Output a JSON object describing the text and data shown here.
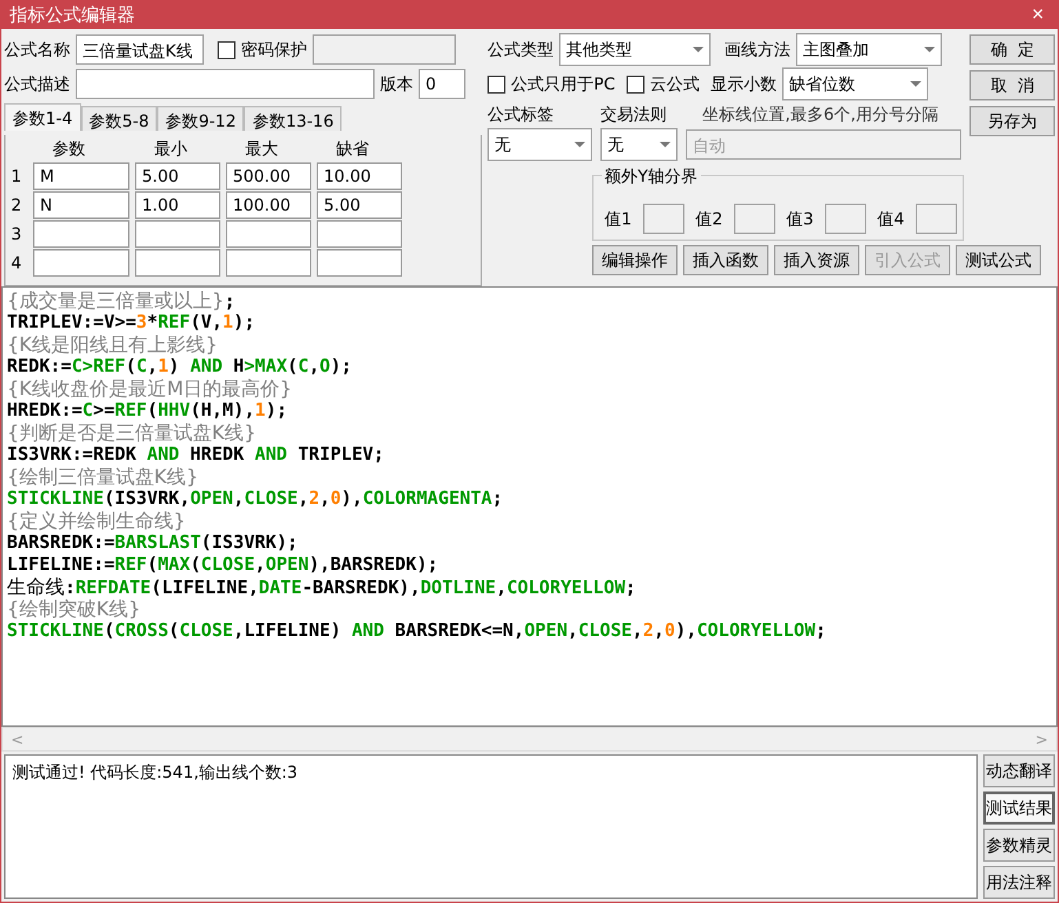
{
  "window": {
    "title": "指标公式编辑器",
    "close": "×"
  },
  "form": {
    "name_label": "公式名称",
    "name_value": "三倍量试盘K线",
    "password": {
      "label": "密码保护",
      "checked": false
    },
    "desc_label": "公式描述",
    "version_label": "版本",
    "version_value": "0",
    "type_label": "公式类型",
    "type_value": "其他类型",
    "draw_label": "画线方法",
    "draw_value": "主图叠加",
    "pc_only": {
      "label": "公式只用于PC",
      "checked": false
    },
    "cloud": {
      "label": "云公式",
      "checked": false
    },
    "decimals_label": "显示小数",
    "decimals_value": "缺省位数",
    "tag_label": "公式标签",
    "tag_value": "无",
    "rule_label": "交易法则",
    "rule_value": "无",
    "axis_label": "坐标线位置,最多6个,用分号分隔",
    "axis_placeholder": "自动",
    "yaxis_title": "额外Y轴分界",
    "yaxis_values": [
      "值1",
      "值2",
      "值3",
      "值4"
    ]
  },
  "tabs": [
    {
      "label": "参数1-4",
      "selected": true
    },
    {
      "label": "参数5-8",
      "selected": false
    },
    {
      "label": "参数9-12",
      "selected": false
    },
    {
      "label": "参数13-16",
      "selected": false
    }
  ],
  "params": {
    "columns": [
      "参数",
      "最小",
      "最大",
      "缺省"
    ],
    "rows": [
      {
        "index": "1",
        "cells": [
          "M",
          "5.00",
          "500.00",
          "10.00"
        ]
      },
      {
        "index": "2",
        "cells": [
          "N",
          "1.00",
          "100.00",
          "5.00"
        ]
      },
      {
        "index": "3",
        "cells": [
          "",
          "",
          "",
          ""
        ]
      },
      {
        "index": "4",
        "cells": [
          "",
          "",
          "",
          ""
        ]
      }
    ]
  },
  "side_buttons": [
    {
      "label": "确  定",
      "disabled": false
    },
    {
      "label": "取  消",
      "disabled": false
    },
    {
      "label": "另存为",
      "disabled": false
    }
  ],
  "tool_buttons": [
    {
      "label": "编辑操作",
      "disabled": false
    },
    {
      "label": "插入函数",
      "disabled": false
    },
    {
      "label": "插入资源",
      "disabled": false
    },
    {
      "label": "引入公式",
      "disabled": true
    },
    {
      "label": "测试公式",
      "disabled": false
    }
  ],
  "code": [
    [
      {
        "kind": "comment",
        "text": "{成交量是三倍量或以上}"
      },
      {
        "kind": "text",
        "text": ";"
      }
    ],
    [
      {
        "kind": "text",
        "text": "TRIPLEV:=V>="
      },
      {
        "kind": "number",
        "text": "3"
      },
      {
        "kind": "text",
        "text": "*"
      },
      {
        "kind": "keyword",
        "text": "REF"
      },
      {
        "kind": "text",
        "text": "(V,"
      },
      {
        "kind": "number",
        "text": "1"
      },
      {
        "kind": "text",
        "text": ");"
      }
    ],
    [
      {
        "kind": "comment",
        "text": "{K线是阳线且有上影线}"
      }
    ],
    [
      {
        "kind": "text",
        "text": "REDK:="
      },
      {
        "kind": "keyword",
        "text": "C>REF"
      },
      {
        "kind": "text",
        "text": "("
      },
      {
        "kind": "keyword",
        "text": "C"
      },
      {
        "kind": "text",
        "text": ","
      },
      {
        "kind": "number",
        "text": "1"
      },
      {
        "kind": "text",
        "text": ") "
      },
      {
        "kind": "keyword",
        "text": "AND"
      },
      {
        "kind": "text",
        "text": " H"
      },
      {
        "kind": "keyword",
        "text": ">MAX"
      },
      {
        "kind": "text",
        "text": "("
      },
      {
        "kind": "keyword",
        "text": "C"
      },
      {
        "kind": "text",
        "text": ","
      },
      {
        "kind": "keyword",
        "text": "O"
      },
      {
        "kind": "text",
        "text": ");"
      }
    ],
    [
      {
        "kind": "comment",
        "text": "{K线收盘价是最近M日的最高价}"
      }
    ],
    [
      {
        "kind": "text",
        "text": "HREDK:="
      },
      {
        "kind": "keyword",
        "text": "C"
      },
      {
        "kind": "text",
        "text": ">="
      },
      {
        "kind": "keyword",
        "text": "REF"
      },
      {
        "kind": "text",
        "text": "("
      },
      {
        "kind": "keyword",
        "text": "HHV"
      },
      {
        "kind": "text",
        "text": "(H,M),"
      },
      {
        "kind": "number",
        "text": "1"
      },
      {
        "kind": "text",
        "text": ");"
      }
    ],
    [
      {
        "kind": "comment",
        "text": "{判断是否是三倍量试盘K线}"
      }
    ],
    [
      {
        "kind": "text",
        "text": "IS3VRK:=REDK "
      },
      {
        "kind": "keyword",
        "text": "AND"
      },
      {
        "kind": "text",
        "text": " HREDK "
      },
      {
        "kind": "keyword",
        "text": "AND"
      },
      {
        "kind": "text",
        "text": " TRIPLEV;"
      }
    ],
    [
      {
        "kind": "comment",
        "text": "{绘制三倍量试盘K线}"
      }
    ],
    [
      {
        "kind": "keyword",
        "text": "STICKLINE"
      },
      {
        "kind": "text",
        "text": "(IS3VRK,"
      },
      {
        "kind": "keyword",
        "text": "OPEN"
      },
      {
        "kind": "text",
        "text": ","
      },
      {
        "kind": "keyword",
        "text": "CLOSE"
      },
      {
        "kind": "text",
        "text": ","
      },
      {
        "kind": "number",
        "text": "2"
      },
      {
        "kind": "text",
        "text": ","
      },
      {
        "kind": "number",
        "text": "0"
      },
      {
        "kind": "text",
        "text": "),"
      },
      {
        "kind": "keyword",
        "text": "COLORMAGENTA"
      },
      {
        "kind": "text",
        "text": ";"
      }
    ],
    [
      {
        "kind": "comment",
        "text": "{定义并绘制生命线}"
      }
    ],
    [
      {
        "kind": "text",
        "text": "BARSREDK:="
      },
      {
        "kind": "keyword",
        "text": "BARSLAST"
      },
      {
        "kind": "text",
        "text": "(IS3VRK);"
      }
    ],
    [
      {
        "kind": "text",
        "text": "LIFELINE:="
      },
      {
        "kind": "keyword",
        "text": "REF"
      },
      {
        "kind": "text",
        "text": "("
      },
      {
        "kind": "keyword",
        "text": "MAX"
      },
      {
        "kind": "text",
        "text": "("
      },
      {
        "kind": "keyword",
        "text": "CLOSE"
      },
      {
        "kind": "text",
        "text": ","
      },
      {
        "kind": "keyword",
        "text": "OPEN"
      },
      {
        "kind": "text",
        "text": "),BARSREDK);"
      }
    ],
    [
      {
        "kind": "label",
        "text": "生命线"
      },
      {
        "kind": "text",
        "text": ":"
      },
      {
        "kind": "keyword",
        "text": "REFDATE"
      },
      {
        "kind": "text",
        "text": "(LIFELINE,"
      },
      {
        "kind": "keyword",
        "text": "DATE"
      },
      {
        "kind": "text",
        "text": "-BARSREDK),"
      },
      {
        "kind": "keyword",
        "text": "DOTLINE"
      },
      {
        "kind": "text",
        "text": ","
      },
      {
        "kind": "keyword",
        "text": "COLORYELLOW"
      },
      {
        "kind": "text",
        "text": ";"
      }
    ],
    [
      {
        "kind": "comment",
        "text": "{绘制突破K线}"
      }
    ],
    [
      {
        "kind": "keyword",
        "text": "STICKLINE"
      },
      {
        "kind": "text",
        "text": "("
      },
      {
        "kind": "keyword",
        "text": "CROSS"
      },
      {
        "kind": "text",
        "text": "("
      },
      {
        "kind": "keyword",
        "text": "CLOSE"
      },
      {
        "kind": "text",
        "text": ",LIFELINE) "
      },
      {
        "kind": "keyword",
        "text": "AND"
      },
      {
        "kind": "text",
        "text": " BARSREDK<=N,"
      },
      {
        "kind": "keyword",
        "text": "OPEN"
      },
      {
        "kind": "text",
        "text": ","
      },
      {
        "kind": "keyword",
        "text": "CLOSE"
      },
      {
        "kind": "text",
        "text": ","
      },
      {
        "kind": "number",
        "text": "2"
      },
      {
        "kind": "text",
        "text": ","
      },
      {
        "kind": "number",
        "text": "0"
      },
      {
        "kind": "text",
        "text": "),"
      },
      {
        "kind": "keyword",
        "text": "COLORYELLOW"
      },
      {
        "kind": "text",
        "text": ";"
      }
    ]
  ],
  "scroll": {
    "left": "<",
    "right": ">"
  },
  "output": "测试通过! 代码长度:541,输出线个数:3",
  "output_tabs": [
    {
      "label": "动态翻译",
      "selected": false
    },
    {
      "label": "测试结果",
      "selected": true
    },
    {
      "label": "参数精灵",
      "selected": false
    },
    {
      "label": "用法注释",
      "selected": false
    }
  ]
}
